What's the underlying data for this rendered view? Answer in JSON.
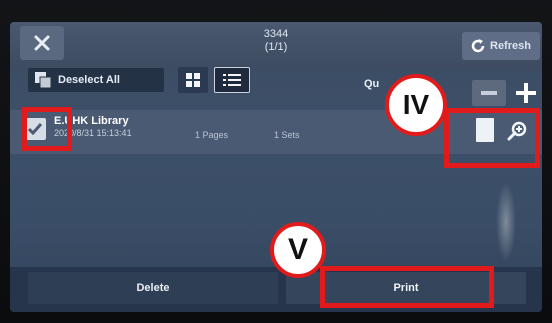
{
  "header": {
    "job_id": "3344",
    "page_indicator": "(1/1)",
    "refresh_label": "Refresh"
  },
  "toolbar": {
    "deselect_all_label": "Deselect All",
    "quantity_label": "Qu",
    "minus_symbol": "—",
    "plus_symbol": "+"
  },
  "job": {
    "name": "E.UHK Library",
    "date": "2020/8/31 15:13:41",
    "pages": "1 Pages",
    "sets": "1 Sets"
  },
  "actions": {
    "delete_label": "Delete",
    "print_label": "Print"
  },
  "callouts": {
    "iv": "IV",
    "v": "V"
  },
  "colors": {
    "annotation_red": "#e11b1b",
    "screen_blue": "#3d5069"
  }
}
